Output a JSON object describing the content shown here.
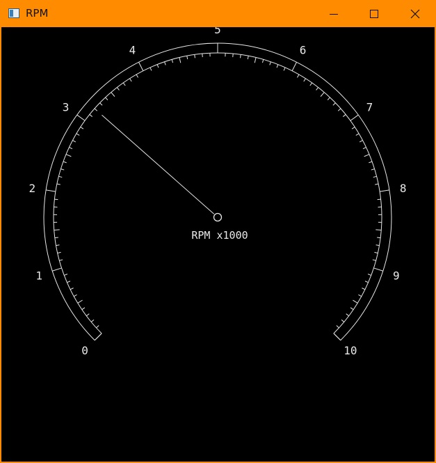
{
  "window": {
    "title": "RPM",
    "accent_color": "#ff8c00",
    "controls": [
      "minimize-icon",
      "maximize-icon",
      "close-icon"
    ]
  },
  "gauge": {
    "background": "#000000",
    "foreground": "#e8e8e8",
    "unit_label": "RPM x1000",
    "scale_min": 0,
    "scale_max": 10,
    "major_labels": [
      "0",
      "1",
      "2",
      "3",
      "4",
      "5",
      "6",
      "7",
      "8",
      "9",
      "10"
    ],
    "minor_divisions_per_major": 10,
    "needle_value": 3.2
  }
}
